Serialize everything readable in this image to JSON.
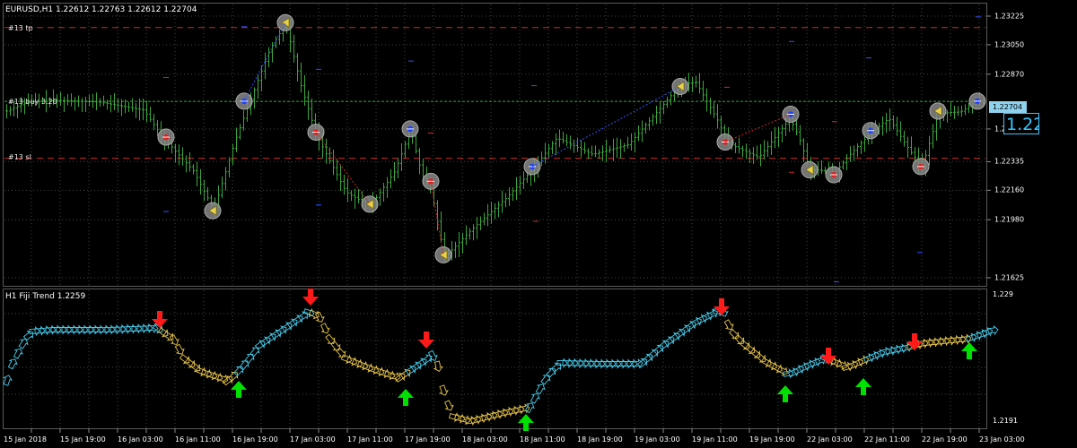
{
  "main_chart": {
    "header": "EURUSD,H1  1.22612 1.22763 1.22612 1.22704",
    "order_lines": [
      {
        "label": "#13 tp",
        "price": 1.23155
      },
      {
        "label": "#13 buy 3.20",
        "price": 1.22704
      },
      {
        "label": "#13 sl",
        "price": 1.22356
      }
    ],
    "price_labels": [
      "1.23225",
      "1.23050",
      "1.22870",
      "1.22535",
      "1.22335",
      "1.22160",
      "1.21980",
      "1.21625"
    ],
    "price_label_values": [
      1.23225,
      1.2305,
      1.2287,
      1.22535,
      1.22335,
      1.2216,
      1.2198,
      1.21625
    ],
    "current_price_label": "1.22704",
    "big_price": "1.22",
    "colors": {
      "candle": "#3aa63a",
      "grid": "#3c4a3c",
      "tp_sl": "#d02828",
      "buy_line": "#3aa63a",
      "price_box": "#8fd2ee",
      "big_price": "#36c6ff"
    }
  },
  "indicator": {
    "header": "H1 Fiji Trend 1.2259",
    "top_label": "1.229",
    "bottom_label": "1.2191",
    "colors": {
      "uptrend": "#47c9e8",
      "downtrend": "#e6c34a",
      "buy_arrow": "#00e000",
      "sell_arrow": "#ff1a1a"
    }
  },
  "time_axis": [
    "15 Jan 2018",
    "15 Jan 19:00",
    "16 Jan 03:00",
    "16 Jan 11:00",
    "16 Jan 19:00",
    "17 Jan 03:00",
    "17 Jan 11:00",
    "17 Jan 19:00",
    "18 Jan 03:00",
    "18 Jan 11:00",
    "18 Jan 19:00",
    "19 Jan 03:00",
    "19 Jan 11:00",
    "19 Jan 19:00",
    "22 Jan 03:00",
    "22 Jan 11:00",
    "22 Jan 19:00",
    "23 Jan 03:00"
  ],
  "trade_markers": [
    {
      "kind": "sell",
      "price": 1.22485
    },
    {
      "kind": "close",
      "price": 1.22035
    },
    {
      "kind": "buy",
      "price": 1.22705
    },
    {
      "kind": "close",
      "price": 1.23185
    },
    {
      "kind": "sell",
      "price": 1.22515
    },
    {
      "kind": "close",
      "price": 1.22075
    },
    {
      "kind": "buy",
      "price": 1.22535
    },
    {
      "kind": "sell",
      "price": 1.22215
    },
    {
      "kind": "close",
      "price": 1.21765
    },
    {
      "kind": "buy",
      "price": 1.22305
    },
    {
      "kind": "close",
      "price": 1.22795
    },
    {
      "kind": "sell",
      "price": 1.22455
    },
    {
      "kind": "buy",
      "price": 1.22625
    },
    {
      "kind": "close",
      "price": 1.22285
    },
    {
      "kind": "sell",
      "price": 1.22255
    },
    {
      "kind": "buy",
      "price": 1.22525
    },
    {
      "kind": "sell",
      "price": 1.22305
    },
    {
      "kind": "close",
      "price": 1.22645
    },
    {
      "kind": "buy",
      "price": 1.22705
    }
  ]
}
